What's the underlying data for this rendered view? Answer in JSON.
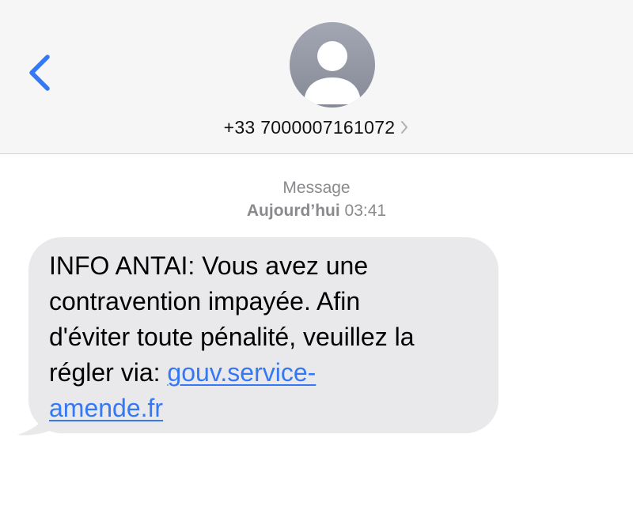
{
  "header": {
    "contact_number": "+33 7000007161072",
    "back_icon": "chevron-left-icon",
    "avatar_icon": "person-silhouette-icon",
    "details_icon": "chevron-right-icon"
  },
  "conversation": {
    "service_label": "Message",
    "day_label": "Aujourd’hui",
    "time_label": "03:41"
  },
  "message": {
    "lines": [
      "INFO ANTAI: Vous avez une",
      "contravention impayée. Afin",
      "d'éviter toute pénalité, veuillez la",
      "régler via: "
    ],
    "link_part1": "gouv.service-",
    "link_part2": "amende.fr"
  },
  "colors": {
    "accent": "#3478f6",
    "bubble_background": "#e9e9eb",
    "header_background": "#f6f6f6",
    "meta_text": "#8a8a8e"
  }
}
